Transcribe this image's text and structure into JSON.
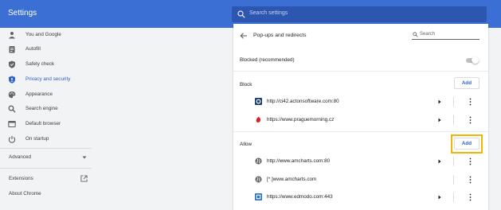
{
  "header": {
    "title": "Settings",
    "search_placeholder": "Search settings"
  },
  "sidebar": {
    "items": [
      {
        "label": "You and Google",
        "icon": "person-icon",
        "active": false
      },
      {
        "label": "Autofill",
        "icon": "clipboard-icon",
        "active": false
      },
      {
        "label": "Safety check",
        "icon": "shield-check-icon",
        "active": false
      },
      {
        "label": "Privacy and security",
        "icon": "shield-icon",
        "active": true
      },
      {
        "label": "Appearance",
        "icon": "palette-icon",
        "active": false
      },
      {
        "label": "Search engine",
        "icon": "search-icon",
        "active": false
      },
      {
        "label": "Default browser",
        "icon": "browser-icon",
        "active": false
      },
      {
        "label": "On startup",
        "icon": "power-icon",
        "active": false
      }
    ],
    "advanced_label": "Advanced",
    "extensions_label": "Extensions",
    "about_label": "About Chrome"
  },
  "panel": {
    "title": "Pop-ups and redirects",
    "search_placeholder": "Search",
    "blocked_label": "Blocked (recommended)",
    "blocked_toggle_on": false,
    "block_section": {
      "label": "Block",
      "add_label": "Add",
      "sites": [
        {
          "url": "http://ci42.actonsoftware.com:80",
          "favicon": "act-on-favicon",
          "has_arrow": true
        },
        {
          "url": "https://www.praguemorning.cz",
          "favicon": "prague-morning-favicon",
          "has_arrow": true
        }
      ]
    },
    "allow_section": {
      "label": "Allow",
      "add_label": "Add",
      "sites": [
        {
          "url": "http://www.amcharts.com:80",
          "favicon": "globe-icon",
          "has_arrow": true
        },
        {
          "url": "[*.]www.amcharts.com",
          "favicon": "globe-icon",
          "has_arrow": false
        },
        {
          "url": "https://www.edmodo.com:443",
          "favicon": "edmodo-favicon",
          "has_arrow": true
        }
      ]
    }
  },
  "colors": {
    "accent": "#3c6fd4",
    "link": "#2f63c9",
    "highlight": "#f4b400"
  }
}
